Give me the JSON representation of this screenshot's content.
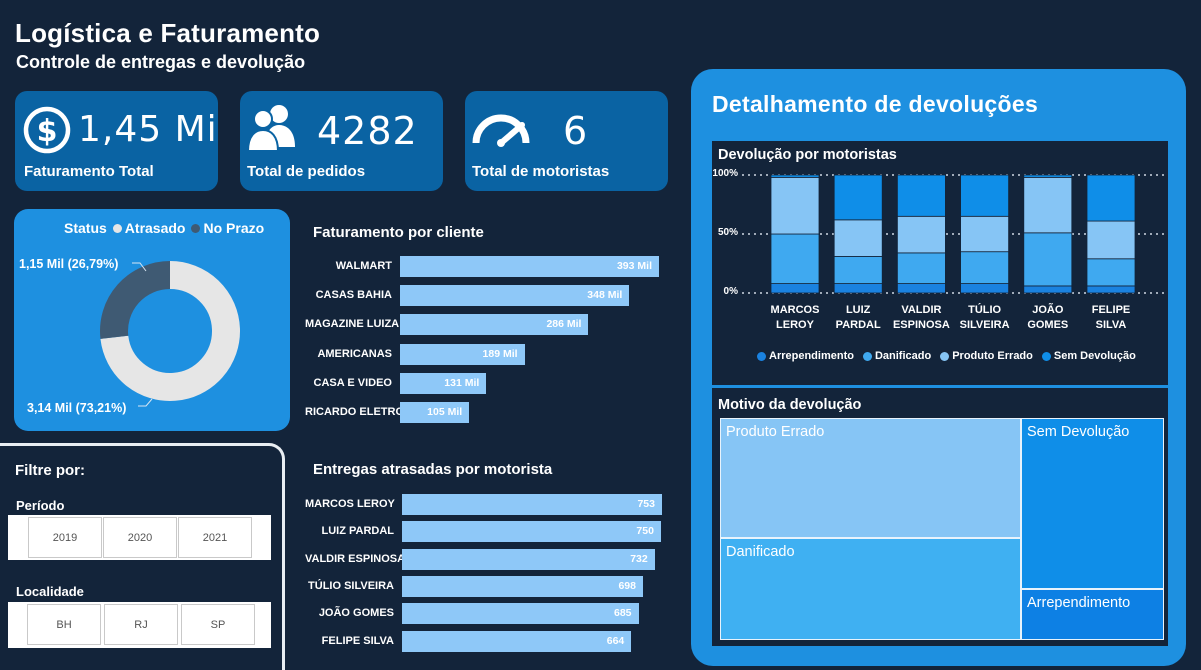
{
  "header": {
    "title": "Logística e Faturamento",
    "subtitle": "Controle de entregas e devolução"
  },
  "kpis": [
    {
      "value": "1,45 Mi",
      "label": "Faturamento Total",
      "icon": "dollar-circle-icon"
    },
    {
      "value": "4282",
      "label": "Total de pedidos",
      "icon": "users-icon"
    },
    {
      "value": "6",
      "label": "Total de motoristas",
      "icon": "speedometer-icon"
    }
  ],
  "status": {
    "legend_title": "Status",
    "legend_items": [
      {
        "label": "Atrasado",
        "color": "#e6e6e6"
      },
      {
        "label": "No Prazo",
        "color": "#3f5a73"
      }
    ],
    "chart_data": {
      "type": "pie",
      "categories": [
        "Atrasado",
        "No Prazo"
      ],
      "values": [
        3.14,
        1.15
      ],
      "percent": [
        73.21,
        26.79
      ],
      "labels": [
        "3,14 Mil (73,21%)",
        "1,15 Mil (26,79%)"
      ]
    }
  },
  "faturamento_cliente": {
    "title": "Faturamento por cliente",
    "chart_data": {
      "type": "bar",
      "categories": [
        "WALMART",
        "CASAS BAHIA",
        "MAGAZINE LUIZA",
        "AMERICANAS",
        "CASA E VIDEO",
        "RICARDO ELETRO"
      ],
      "values": [
        393,
        348,
        286,
        189,
        131,
        105
      ],
      "value_labels": [
        "393 Mil",
        "348 Mil",
        "286 Mil",
        "189 Mil",
        "131 Mil",
        "105 Mil"
      ]
    }
  },
  "entregas_atrasadas": {
    "title": "Entregas atrasadas por motorista",
    "chart_data": {
      "type": "bar",
      "categories": [
        "MARCOS LEROY",
        "LUIZ PARDAL",
        "VALDIR ESPINOSA",
        "TÚLIO SILVEIRA",
        "JOÃO GOMES",
        "FELIPE SILVA"
      ],
      "values": [
        753,
        750,
        732,
        698,
        685,
        664
      ]
    }
  },
  "filters": {
    "title": "Filtre por:",
    "period_label": "Período",
    "periods": [
      "2019",
      "2020",
      "2021"
    ],
    "location_label": "Localidade",
    "locations": [
      "BH",
      "RJ",
      "SP"
    ]
  },
  "detail": {
    "title": "Detalhamento de devoluções",
    "devolucao_motoristas": {
      "title": "Devolução por motoristas",
      "y_ticks": [
        "100%",
        "50%",
        "0%"
      ],
      "chart_data": {
        "type": "bar",
        "stacked": "percent",
        "categories": [
          "MARCOS LEROY",
          "LUIZ PARDAL",
          "VALDIR ESPINOSA",
          "TÚLIO SILVEIRA",
          "JOÃO GOMES",
          "FELIPE SILVA"
        ],
        "category_lines": [
          [
            "MARCOS",
            "LEROY"
          ],
          [
            "LUIZ",
            "PARDAL"
          ],
          [
            "VALDIR",
            "ESPINOSA"
          ],
          [
            "TÚLIO",
            "SILVEIRA"
          ],
          [
            "JOÃO",
            "GOMES"
          ],
          [
            "FELIPE",
            "SILVA"
          ]
        ],
        "ylim": [
          0,
          100
        ],
        "series": [
          {
            "name": "Arrependimento",
            "color": "#1a82e0",
            "values": [
              8,
              8,
              8,
              8,
              6,
              6
            ]
          },
          {
            "name": "Danificado",
            "color": "#3fa9f0",
            "values": [
              42,
              23,
              26,
              27,
              45,
              23
            ]
          },
          {
            "name": "Produto Errado",
            "color": "#86c5f5",
            "values": [
              48,
              31,
              31,
              30,
              47,
              32
            ]
          },
          {
            "name": "Sem Devolução",
            "color": "#0f8ee8",
            "values": [
              2,
              38,
              35,
              35,
              2,
              39
            ]
          }
        ]
      }
    },
    "motivo": {
      "title": "Motivo da devolução",
      "chart_data": {
        "type": "treemap",
        "categories": [
          "Produto Errado",
          "Danificado",
          "Sem Devolução",
          "Arrependimento"
        ],
        "colors": [
          "#86c5f5",
          "#3fb0f2",
          "#0f8ee8",
          "#0d80e4"
        ]
      }
    }
  }
}
